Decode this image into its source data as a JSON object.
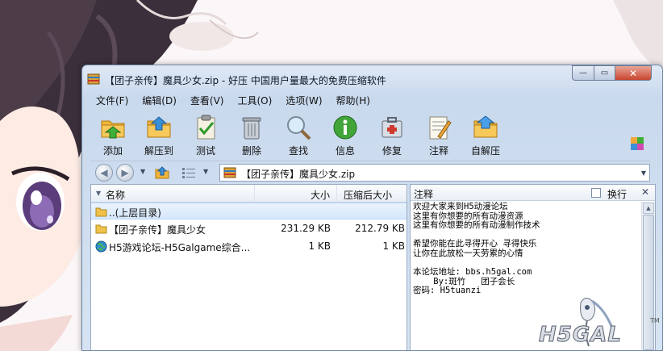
{
  "window": {
    "title": "【团子亲传】魔具少女.zip - 好压 中国用户量最大的免费压缩软件"
  },
  "menu": [
    {
      "label": "文件(F)"
    },
    {
      "label": "编辑(D)"
    },
    {
      "label": "查看(V)"
    },
    {
      "label": "工具(O)"
    },
    {
      "label": "选项(W)"
    },
    {
      "label": "帮助(H)"
    }
  ],
  "toolbar": [
    {
      "label": "添加",
      "icon": "add-icon"
    },
    {
      "label": "解压到",
      "icon": "extract-icon"
    },
    {
      "label": "测试",
      "icon": "test-icon"
    },
    {
      "label": "删除",
      "icon": "delete-icon"
    },
    {
      "label": "查找",
      "icon": "find-icon"
    },
    {
      "label": "信息",
      "icon": "info-icon"
    },
    {
      "label": "修复",
      "icon": "repair-icon"
    },
    {
      "label": "注释",
      "icon": "comment-icon"
    },
    {
      "label": "自解压",
      "icon": "sfx-icon"
    }
  ],
  "address": {
    "path": "【团子亲传】魔具少女.zip"
  },
  "filelist": {
    "columns": {
      "name": "名称",
      "size": "大小",
      "packed": "压缩后大小"
    },
    "rows": [
      {
        "name": "..(上层目录)",
        "size": "",
        "packed": "",
        "icon": "parent-folder-icon"
      },
      {
        "name": "【团子亲传】魔具少女",
        "size": "231.29 KB",
        "packed": "212.79 KB",
        "icon": "folder-icon"
      },
      {
        "name": "H5游戏论坛-H5Galgame综合...",
        "size": "1 KB",
        "packed": "1 KB",
        "icon": "internet-shortcut-icon"
      }
    ]
  },
  "comment": {
    "title": "注释",
    "wrap_label": "换行",
    "text": "欢迎大家来到H5动漫论坛\n这里有你想要的所有动漫资源\n这里有你想要的所有动漫制作技术\n\n希望你能在此寻得开心 寻得快乐\n让你在此放松一天劳累的心情\n\n本论坛地址: bbs.h5gal.com\n    By:斑竹   团子会长\n密码: H5tuanzi"
  },
  "watermark": {
    "logo_text": "H5GAL",
    "tm": "TM"
  }
}
